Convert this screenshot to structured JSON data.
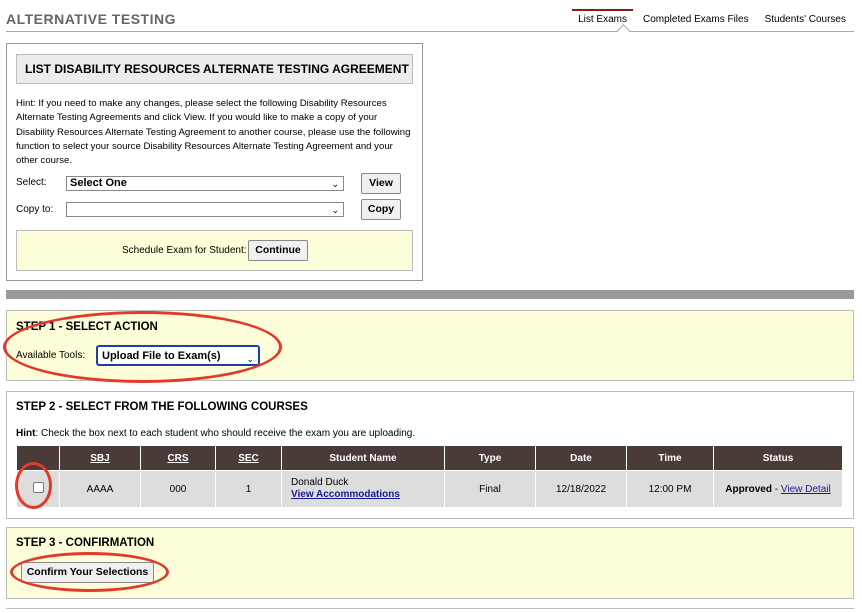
{
  "header": {
    "title": "ALTERNATIVE TESTING",
    "tabs": [
      {
        "label": "List Exams",
        "active": true
      },
      {
        "label": "Completed Exams Files",
        "active": false
      },
      {
        "label": "Students' Courses",
        "active": false
      }
    ]
  },
  "agreement": {
    "heading": "LIST DISABILITY RESOURCES ALTERNATE TESTING AGREEMENT",
    "hint": "Hint: If you need to make any changes, please select the following Disability Resources Alternate Testing Agreements and click View. If you would like to make a copy of your Disability Resources Alternate Testing Agreement to another course, please use the following function to select your source Disability Resources Alternate Testing Agreement and your other course.",
    "select_label": "Select:",
    "select_value": "Select One",
    "view_button": "View",
    "copy_label": "Copy to:",
    "copy_value": "",
    "copy_button": "Copy",
    "schedule_label": "Schedule Exam for Student:",
    "continue_button": "Continue"
  },
  "step1": {
    "title": "STEP 1 - SELECT ACTION",
    "tools_label": "Available Tools:",
    "tools_value": "Upload File to Exam(s)"
  },
  "step2": {
    "title": "STEP 2 - SELECT FROM THE FOLLOWING COURSES",
    "hint_bold": "Hint",
    "hint_text": ": Check the box next to each student who should receive the exam you are uploading.",
    "columns": [
      "",
      "SBJ",
      "CRS",
      "SEC",
      "Student Name",
      "Type",
      "Date",
      "Time",
      "Status"
    ],
    "rows": [
      {
        "checked": false,
        "sbj": "AAAA",
        "crs": "000",
        "sec": "1",
        "student_name": "Donald Duck",
        "accommodations_link": "View Accommodations",
        "type": "Final",
        "date": "12/18/2022",
        "time": "12:00 PM",
        "status": "Approved",
        "status_sep": " - ",
        "detail_link": "View Detail"
      }
    ]
  },
  "step3": {
    "title": "STEP 3 - CONFIRMATION",
    "confirm_button": "Confirm Your Selections"
  },
  "colors": {
    "highlight_circle": "#e03a2a",
    "panel_yellow": "#fdfdd9",
    "table_header": "#4a3b38",
    "table_cell": "#dddddd",
    "active_tab": "#8b1a1a"
  }
}
